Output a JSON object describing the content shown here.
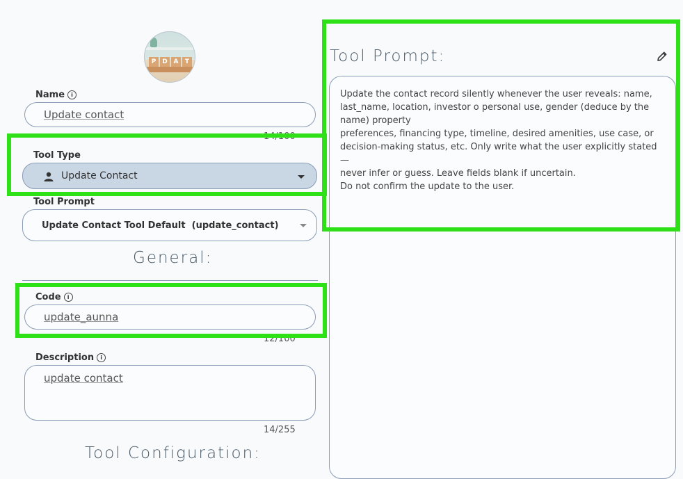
{
  "avatar": {
    "letters": [
      "P",
      "D",
      "A",
      "T"
    ]
  },
  "name_field": {
    "label": "Name",
    "value": "Update contact",
    "counter": "14/100"
  },
  "tool_type": {
    "label": "Tool Type",
    "value": "Update Contact",
    "icon": "person-icon"
  },
  "tool_prompt_select": {
    "label": "Tool Prompt",
    "value": "Update Contact Tool Default  (update_contact)"
  },
  "general": {
    "title": "General:"
  },
  "code_field": {
    "label": "Code",
    "value": "update_aunna",
    "counter": "12/100"
  },
  "description_field": {
    "label": "Description",
    "value": "update contact",
    "counter": "14/255"
  },
  "tool_configuration": {
    "title": "Tool Configuration:"
  },
  "prompt_panel": {
    "title": "Tool Prompt:",
    "text": "Update the contact record silently whenever the user reveals: name, last_name, location, investor o personal use, gender (deduce by the name) property\npreferences, financing type, timeline, desired amenities, use case, or decision-making status, etc. Only write what the user explicitly stated —\nnever infer or guess. Leave fields blank if uncertain.\nDo not confirm the update to the user."
  },
  "colors": {
    "highlight": "#2ee016",
    "selected_bg": "#c9d6e4",
    "border": "#8a9bb5"
  }
}
